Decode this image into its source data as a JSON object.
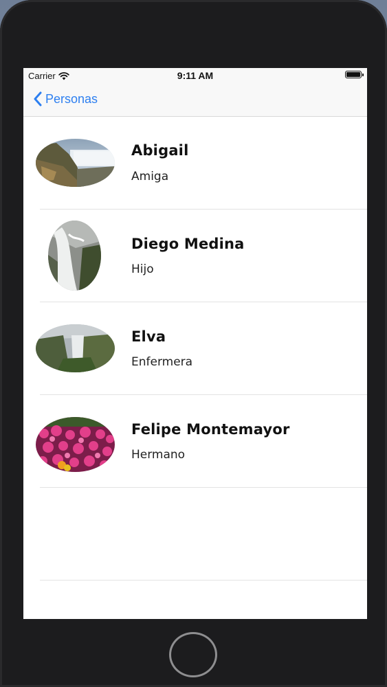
{
  "status_bar": {
    "carrier": "Carrier",
    "time": "9:11 AM",
    "wifi_icon": "wifi-icon",
    "battery_icon": "battery-icon"
  },
  "nav": {
    "back_label": "Personas",
    "back_icon": "chevron-left-icon",
    "accent_color": "#2d7ff0"
  },
  "contacts": [
    {
      "name": "Abigail",
      "relation": "Amiga",
      "image": "waterfall-cliff-photo"
    },
    {
      "name": "Diego Medina",
      "relation": "Hijo",
      "image": "waterfall-stream-photo"
    },
    {
      "name": "Elva",
      "relation": "Enfermera",
      "image": "misty-waterfall-photo"
    },
    {
      "name": "Felipe Montemayor",
      "relation": "Hermano",
      "image": "pink-flowers-photo"
    }
  ]
}
